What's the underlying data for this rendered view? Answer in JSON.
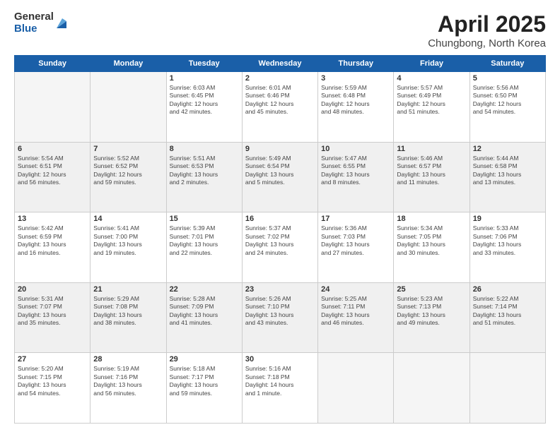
{
  "header": {
    "logo_general": "General",
    "logo_blue": "Blue",
    "title": "April 2025",
    "location": "Chungbong, North Korea"
  },
  "days_of_week": [
    "Sunday",
    "Monday",
    "Tuesday",
    "Wednesday",
    "Thursday",
    "Friday",
    "Saturday"
  ],
  "weeks": [
    [
      {
        "day": "",
        "info": ""
      },
      {
        "day": "",
        "info": ""
      },
      {
        "day": "1",
        "info": "Sunrise: 6:03 AM\nSunset: 6:45 PM\nDaylight: 12 hours\nand 42 minutes."
      },
      {
        "day": "2",
        "info": "Sunrise: 6:01 AM\nSunset: 6:46 PM\nDaylight: 12 hours\nand 45 minutes."
      },
      {
        "day": "3",
        "info": "Sunrise: 5:59 AM\nSunset: 6:48 PM\nDaylight: 12 hours\nand 48 minutes."
      },
      {
        "day": "4",
        "info": "Sunrise: 5:57 AM\nSunset: 6:49 PM\nDaylight: 12 hours\nand 51 minutes."
      },
      {
        "day": "5",
        "info": "Sunrise: 5:56 AM\nSunset: 6:50 PM\nDaylight: 12 hours\nand 54 minutes."
      }
    ],
    [
      {
        "day": "6",
        "info": "Sunrise: 5:54 AM\nSunset: 6:51 PM\nDaylight: 12 hours\nand 56 minutes."
      },
      {
        "day": "7",
        "info": "Sunrise: 5:52 AM\nSunset: 6:52 PM\nDaylight: 12 hours\nand 59 minutes."
      },
      {
        "day": "8",
        "info": "Sunrise: 5:51 AM\nSunset: 6:53 PM\nDaylight: 13 hours\nand 2 minutes."
      },
      {
        "day": "9",
        "info": "Sunrise: 5:49 AM\nSunset: 6:54 PM\nDaylight: 13 hours\nand 5 minutes."
      },
      {
        "day": "10",
        "info": "Sunrise: 5:47 AM\nSunset: 6:55 PM\nDaylight: 13 hours\nand 8 minutes."
      },
      {
        "day": "11",
        "info": "Sunrise: 5:46 AM\nSunset: 6:57 PM\nDaylight: 13 hours\nand 11 minutes."
      },
      {
        "day": "12",
        "info": "Sunrise: 5:44 AM\nSunset: 6:58 PM\nDaylight: 13 hours\nand 13 minutes."
      }
    ],
    [
      {
        "day": "13",
        "info": "Sunrise: 5:42 AM\nSunset: 6:59 PM\nDaylight: 13 hours\nand 16 minutes."
      },
      {
        "day": "14",
        "info": "Sunrise: 5:41 AM\nSunset: 7:00 PM\nDaylight: 13 hours\nand 19 minutes."
      },
      {
        "day": "15",
        "info": "Sunrise: 5:39 AM\nSunset: 7:01 PM\nDaylight: 13 hours\nand 22 minutes."
      },
      {
        "day": "16",
        "info": "Sunrise: 5:37 AM\nSunset: 7:02 PM\nDaylight: 13 hours\nand 24 minutes."
      },
      {
        "day": "17",
        "info": "Sunrise: 5:36 AM\nSunset: 7:03 PM\nDaylight: 13 hours\nand 27 minutes."
      },
      {
        "day": "18",
        "info": "Sunrise: 5:34 AM\nSunset: 7:05 PM\nDaylight: 13 hours\nand 30 minutes."
      },
      {
        "day": "19",
        "info": "Sunrise: 5:33 AM\nSunset: 7:06 PM\nDaylight: 13 hours\nand 33 minutes."
      }
    ],
    [
      {
        "day": "20",
        "info": "Sunrise: 5:31 AM\nSunset: 7:07 PM\nDaylight: 13 hours\nand 35 minutes."
      },
      {
        "day": "21",
        "info": "Sunrise: 5:29 AM\nSunset: 7:08 PM\nDaylight: 13 hours\nand 38 minutes."
      },
      {
        "day": "22",
        "info": "Sunrise: 5:28 AM\nSunset: 7:09 PM\nDaylight: 13 hours\nand 41 minutes."
      },
      {
        "day": "23",
        "info": "Sunrise: 5:26 AM\nSunset: 7:10 PM\nDaylight: 13 hours\nand 43 minutes."
      },
      {
        "day": "24",
        "info": "Sunrise: 5:25 AM\nSunset: 7:11 PM\nDaylight: 13 hours\nand 46 minutes."
      },
      {
        "day": "25",
        "info": "Sunrise: 5:23 AM\nSunset: 7:13 PM\nDaylight: 13 hours\nand 49 minutes."
      },
      {
        "day": "26",
        "info": "Sunrise: 5:22 AM\nSunset: 7:14 PM\nDaylight: 13 hours\nand 51 minutes."
      }
    ],
    [
      {
        "day": "27",
        "info": "Sunrise: 5:20 AM\nSunset: 7:15 PM\nDaylight: 13 hours\nand 54 minutes."
      },
      {
        "day": "28",
        "info": "Sunrise: 5:19 AM\nSunset: 7:16 PM\nDaylight: 13 hours\nand 56 minutes."
      },
      {
        "day": "29",
        "info": "Sunrise: 5:18 AM\nSunset: 7:17 PM\nDaylight: 13 hours\nand 59 minutes."
      },
      {
        "day": "30",
        "info": "Sunrise: 5:16 AM\nSunset: 7:18 PM\nDaylight: 14 hours\nand 1 minute."
      },
      {
        "day": "",
        "info": ""
      },
      {
        "day": "",
        "info": ""
      },
      {
        "day": "",
        "info": ""
      }
    ]
  ]
}
